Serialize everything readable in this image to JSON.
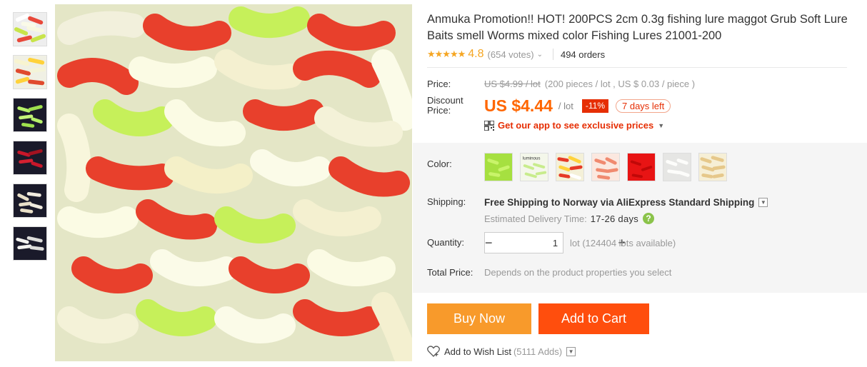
{
  "product": {
    "title": "Anmuka Promotion!! HOT! 200PCS 2cm 0.3g fishing lure maggot Grub Soft Lure Baits smell Worms mixed color Fishing Lures 21001-200",
    "stars": "★★★★★",
    "rating": "4.8",
    "votes": "(654 votes)",
    "orders": "494 orders"
  },
  "thumbnails": [
    {
      "name": "mixed-color-grubs",
      "colors": [
        "#fff",
        "#e8483a",
        "#c8e44a"
      ]
    },
    {
      "name": "mixed-color-grubs-2",
      "colors": [
        "#f4f4d8",
        "#e04a2e",
        "#ffd23a"
      ]
    },
    {
      "name": "green-grubs",
      "colors": [
        "#b6f06a",
        "#9ee04e"
      ]
    },
    {
      "name": "red-grubs",
      "colors": [
        "#c8172a",
        "#a31220"
      ]
    },
    {
      "name": "white-beige-grubs",
      "colors": [
        "#e8dfc8",
        "#f1ece0"
      ]
    },
    {
      "name": "white-grubs",
      "colors": [
        "#f2f2f0",
        "#dcdcda"
      ]
    }
  ],
  "pricing": {
    "price_label": "Price:",
    "old_price": "US $4.99 / lot",
    "pieces_info": "(200 pieces / lot , US $ 0.03 / piece )",
    "discount_label_1": "Discount",
    "discount_label_2": "Price:",
    "discount_price": "US $4.44",
    "unit": "/ lot",
    "discount_badge": "-11%",
    "days_left": "7 days left",
    "app_promo": "Get our app to see exclusive prices"
  },
  "options": {
    "color_label": "Color:",
    "swatches": [
      {
        "name": "green",
        "label": ""
      },
      {
        "name": "luminous",
        "label": "luminous"
      },
      {
        "name": "mixed",
        "label": ""
      },
      {
        "name": "pink",
        "label": ""
      },
      {
        "name": "red",
        "label": ""
      },
      {
        "name": "white",
        "label": ""
      },
      {
        "name": "beige",
        "label": ""
      }
    ],
    "shipping_label": "Shipping:",
    "shipping_text": "Free Shipping to Norway via AliExpress Standard Shipping",
    "delivery_label": "Estimated Delivery Time:",
    "delivery_value": "17-26 days",
    "quantity_label": "Quantity:",
    "quantity_value": "1",
    "quantity_available": "lot (124404 lots available)",
    "total_label": "Total Price:",
    "total_value": "Depends on the product properties you select"
  },
  "actions": {
    "buy_now": "Buy Now",
    "add_to_cart": "Add to Cart",
    "wish_list": "Add to Wish List",
    "wish_count": "(5111 Adds)"
  },
  "colors": {
    "accent_orange": "#f60",
    "buy_now_bg": "#f89a2b",
    "add_cart_bg": "#ff4e0d",
    "discount_red": "#e62e04",
    "star_gold": "#f5a623"
  }
}
